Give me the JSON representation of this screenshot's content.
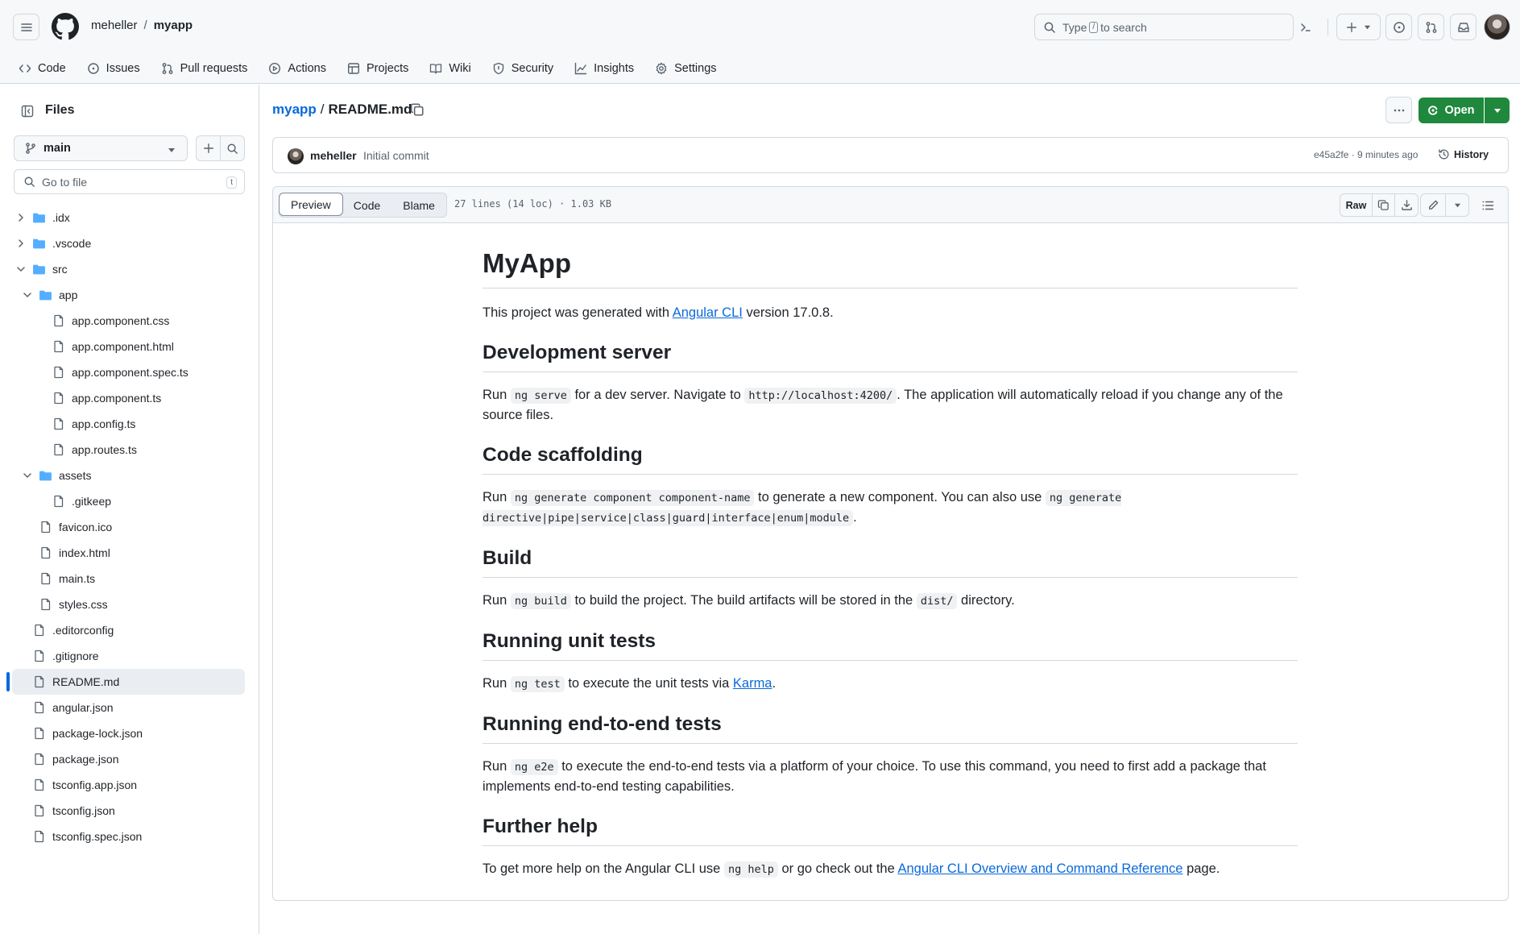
{
  "header": {
    "owner": "meheller",
    "separator": "/",
    "repo": "myapp",
    "search_prefix": "Type",
    "search_key": "/",
    "search_suffix": "to search"
  },
  "repo_nav": [
    {
      "label": "Code",
      "icon": "code-icon",
      "active": true
    },
    {
      "label": "Issues",
      "icon": "issue-icon"
    },
    {
      "label": "Pull requests",
      "icon": "pull-request-icon"
    },
    {
      "label": "Actions",
      "icon": "play-icon"
    },
    {
      "label": "Projects",
      "icon": "table-icon"
    },
    {
      "label": "Wiki",
      "icon": "book-icon"
    },
    {
      "label": "Security",
      "icon": "shield-icon"
    },
    {
      "label": "Insights",
      "icon": "graph-icon"
    },
    {
      "label": "Settings",
      "icon": "gear-icon"
    }
  ],
  "sidebar": {
    "title": "Files",
    "branch": "main",
    "goto_placeholder": "Go to file",
    "goto_key": "t",
    "tree": [
      {
        "name": ".idx",
        "type": "folder",
        "depth": 0,
        "open": false
      },
      {
        "name": ".vscode",
        "type": "folder",
        "depth": 0,
        "open": false
      },
      {
        "name": "src",
        "type": "folder",
        "depth": 0,
        "open": true
      },
      {
        "name": "app",
        "type": "folder",
        "depth": 1,
        "open": true
      },
      {
        "name": "app.component.css",
        "type": "file",
        "depth": 2
      },
      {
        "name": "app.component.html",
        "type": "file",
        "depth": 2
      },
      {
        "name": "app.component.spec.ts",
        "type": "file",
        "depth": 2
      },
      {
        "name": "app.component.ts",
        "type": "file",
        "depth": 2
      },
      {
        "name": "app.config.ts",
        "type": "file",
        "depth": 2
      },
      {
        "name": "app.routes.ts",
        "type": "file",
        "depth": 2
      },
      {
        "name": "assets",
        "type": "folder",
        "depth": 1,
        "open": true
      },
      {
        "name": ".gitkeep",
        "type": "file",
        "depth": 2
      },
      {
        "name": "favicon.ico",
        "type": "file",
        "depth": 1
      },
      {
        "name": "index.html",
        "type": "file",
        "depth": 1
      },
      {
        "name": "main.ts",
        "type": "file",
        "depth": 1
      },
      {
        "name": "styles.css",
        "type": "file",
        "depth": 1
      },
      {
        "name": ".editorconfig",
        "type": "file",
        "depth": 0
      },
      {
        "name": ".gitignore",
        "type": "file",
        "depth": 0
      },
      {
        "name": "README.md",
        "type": "file",
        "depth": 0,
        "selected": true
      },
      {
        "name": "angular.json",
        "type": "file",
        "depth": 0
      },
      {
        "name": "package-lock.json",
        "type": "file",
        "depth": 0
      },
      {
        "name": "package.json",
        "type": "file",
        "depth": 0
      },
      {
        "name": "tsconfig.app.json",
        "type": "file",
        "depth": 0
      },
      {
        "name": "tsconfig.json",
        "type": "file",
        "depth": 0
      },
      {
        "name": "tsconfig.spec.json",
        "type": "file",
        "depth": 0
      }
    ]
  },
  "file": {
    "repo_link": "myapp",
    "separator": "/",
    "name": "README.md",
    "open_label": "Open",
    "commit_author": "meheller",
    "commit_message": "Initial commit",
    "commit_meta": "e45a2fe · 9 minutes ago",
    "history_label": "History",
    "tabs": [
      "Preview",
      "Code",
      "Blame"
    ],
    "stats": "27 lines (14 loc) · 1.03 KB",
    "raw_label": "Raw"
  },
  "readme": {
    "h1": "MyApp",
    "intro_a": "This project was generated with ",
    "intro_link": "Angular CLI",
    "intro_b": " version 17.0.8.",
    "dev_h": "Development server",
    "dev_a": "Run ",
    "dev_code1": "ng serve",
    "dev_b": " for a dev server. Navigate to ",
    "dev_code2": "http://localhost:4200/",
    "dev_c": ". The application will automatically reload if you change any of the source files.",
    "scaf_h": "Code scaffolding",
    "scaf_a": "Run ",
    "scaf_code1": "ng generate component component-name",
    "scaf_b": " to generate a new component. You can also use ",
    "scaf_code2": "ng generate directive|pipe|service|class|guard|interface|enum|module",
    "scaf_c": ".",
    "build_h": "Build",
    "build_a": "Run ",
    "build_code1": "ng build",
    "build_b": " to build the project. The build artifacts will be stored in the ",
    "build_code2": "dist/",
    "build_c": " directory.",
    "unit_h": "Running unit tests",
    "unit_a": "Run ",
    "unit_code": "ng test",
    "unit_b": " to execute the unit tests via ",
    "unit_link": "Karma",
    "unit_c": ".",
    "e2e_h": "Running end-to-end tests",
    "e2e_a": "Run ",
    "e2e_code": "ng e2e",
    "e2e_b": " to execute the end-to-end tests via a platform of your choice. To use this command, you need to first add a package that implements end-to-end testing capabilities.",
    "help_h": "Further help",
    "help_a": "To get more help on the Angular CLI use ",
    "help_code": "ng help",
    "help_b": " or go check out the ",
    "help_link": "Angular CLI Overview and Command Reference",
    "help_c": " page."
  }
}
